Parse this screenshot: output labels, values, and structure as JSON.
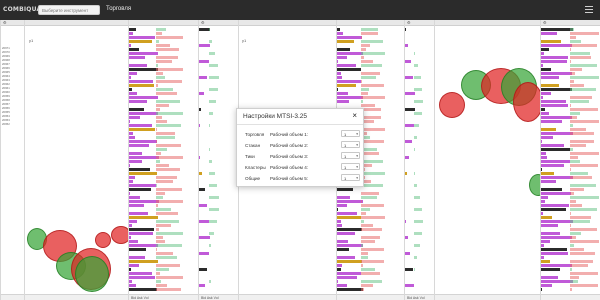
{
  "topbar": {
    "logo": "COMBIQUANT",
    "instrument_placeholder": "Выберите инструмент",
    "trades_link": "Торговля"
  },
  "panels": {
    "axis_label": "y1",
    "footer_labels": [
      "Bid",
      "Ask",
      "Vol"
    ]
  },
  "settings_dialog": {
    "title": "Настройки MTSI-3.25",
    "rows": [
      {
        "name": "Торговля",
        "value": "Рабочий объем 1:",
        "select": "1"
      },
      {
        "name": "Стакан",
        "value": "Рабочий объем 2:",
        "select": "1"
      },
      {
        "name": "Тики",
        "value": "Рабочий объем 3:",
        "select": "1"
      },
      {
        "name": "Кластеры",
        "value": "Рабочий объем 4:",
        "select": "1"
      },
      {
        "name": "Общие",
        "value": "Рабочий объем 5:",
        "select": "1"
      }
    ]
  },
  "colors": {
    "ask": "#e86b6b",
    "bid": "#6cc58a",
    "volume": "#c05ad8",
    "highlight": "#d0a020",
    "dark_bar": "#2b2b2b"
  },
  "price_ladder": [
    "20971",
    "20970",
    "20969",
    "20968",
    "20967",
    "20966",
    "20965",
    "20964",
    "20963",
    "20962",
    "20961",
    "20960",
    "20959",
    "20958",
    "20957",
    "20956",
    "20955",
    "20954",
    "20953",
    "20952"
  ]
}
